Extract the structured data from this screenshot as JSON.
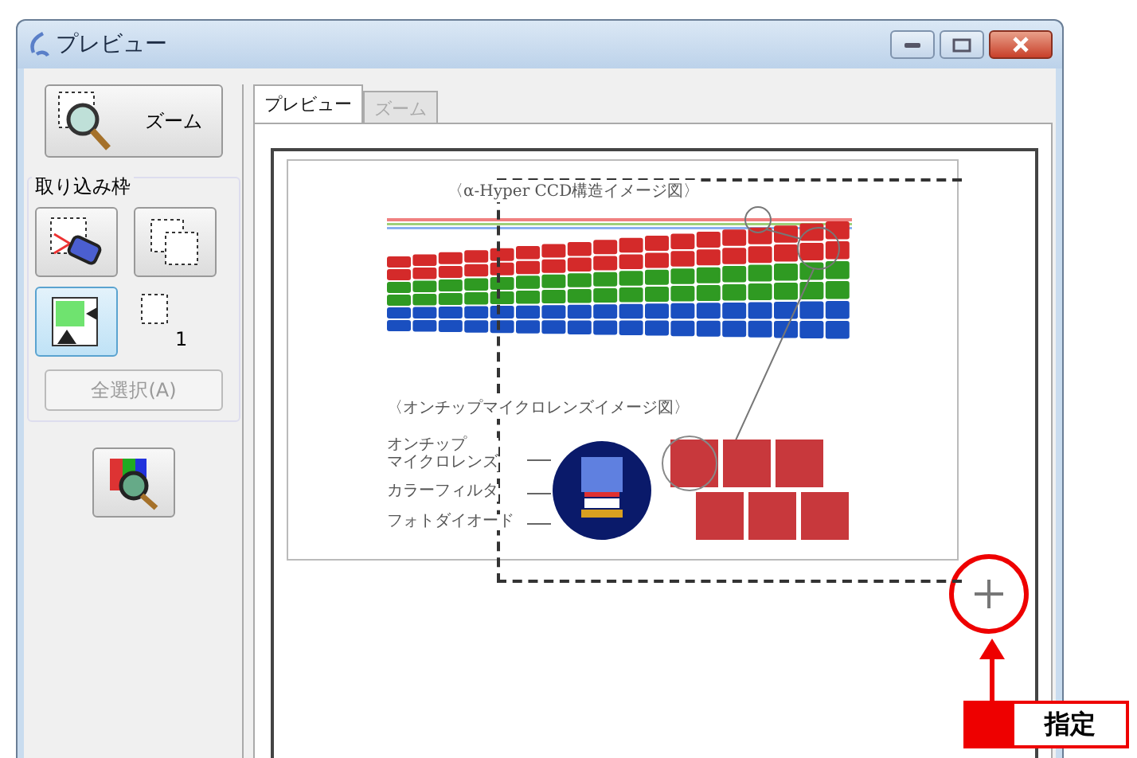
{
  "window": {
    "title": "プレビュー"
  },
  "sidebar": {
    "zoom_button": "ズーム",
    "frame_group": {
      "title": "取り込み枠",
      "frame_count": "1",
      "select_all_button": "全選択(A)",
      "select_all_disabled": true
    }
  },
  "tabs": [
    {
      "label": "プレビュー",
      "selected": true
    },
    {
      "label": "ズーム",
      "selected": false
    }
  ],
  "preview": {
    "title": "〈α-Hyper CCD構造イメージ図〉",
    "subtitle": "〈オンチップマイクロレンズイメージ図〉",
    "labels": [
      {
        "lines": [
          "オンチップ",
          "マイクロレンズ"
        ]
      },
      {
        "lines": [
          "カラーフィルタ"
        ]
      },
      {
        "lines": [
          "フォトダイオード"
        ]
      }
    ]
  },
  "annotation": {
    "label": "指定"
  }
}
